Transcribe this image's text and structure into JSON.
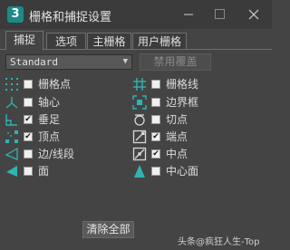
{
  "window": {
    "title": "栅格和捕捉设置",
    "app_icon": "3"
  },
  "tabs": [
    {
      "label": "捕捉",
      "active": true
    },
    {
      "label": "选项",
      "active": false
    },
    {
      "label": "主栅格",
      "active": false
    },
    {
      "label": "用户栅格",
      "active": false
    }
  ],
  "toolbar": {
    "snap_type": "Standard",
    "override_label": "禁用覆盖"
  },
  "snaps": {
    "left": [
      {
        "label": "栅格点",
        "checked": false,
        "icon": "grid-points-icon"
      },
      {
        "label": "轴心",
        "checked": false,
        "icon": "pivot-icon"
      },
      {
        "label": "垂足",
        "checked": true,
        "icon": "perpendicular-icon"
      },
      {
        "label": "顶点",
        "checked": true,
        "icon": "vertex-icon"
      },
      {
        "label": "边/线段",
        "checked": false,
        "icon": "edge-segment-icon"
      },
      {
        "label": "面",
        "checked": false,
        "icon": "face-icon"
      }
    ],
    "right": [
      {
        "label": "栅格线",
        "checked": false,
        "icon": "grid-lines-icon"
      },
      {
        "label": "边界框",
        "checked": false,
        "icon": "bounding-box-icon"
      },
      {
        "label": "切点",
        "checked": false,
        "icon": "tangent-icon"
      },
      {
        "label": "端点",
        "checked": true,
        "icon": "endpoint-icon"
      },
      {
        "label": "中点",
        "checked": true,
        "icon": "midpoint-icon"
      },
      {
        "label": "中心面",
        "checked": false,
        "icon": "center-face-icon"
      }
    ]
  },
  "footer": {
    "clear_all_label": "清除全部"
  },
  "watermark": "头条@疯狂人生-Top",
  "colors": {
    "background": "#444444",
    "titlebar": "#3b3b3b",
    "icon_teal": "#2fb3b3",
    "text": "#dcdcdc"
  }
}
